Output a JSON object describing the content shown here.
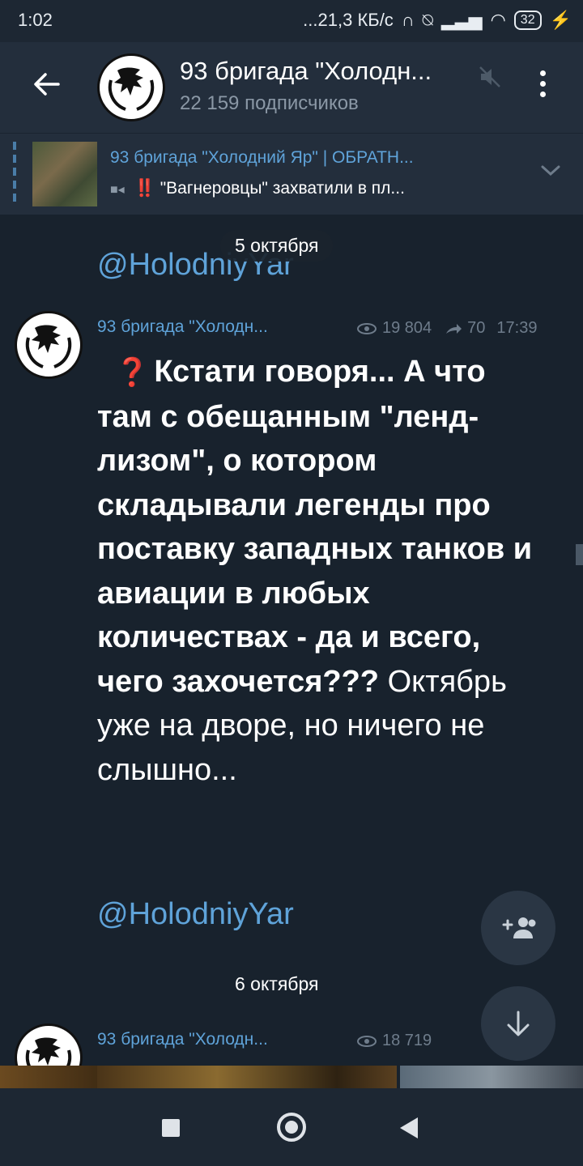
{
  "status_bar": {
    "time": "1:02",
    "speed": "...21,3 КБ/с",
    "battery": "32"
  },
  "header": {
    "channel_name": "93 бригада \"Холодн...",
    "subscribers": "22 159 подписчиков"
  },
  "pinned": {
    "title": "93 бригада \"Холодний Яр\" | ОБРАТН...",
    "text": "\"Вагнеровцы\" захватили в пл...",
    "excl": "‼️"
  },
  "feed": {
    "partial_link": "@HolodniyYar",
    "date_1": "5 октября",
    "message": {
      "author": "93 бригада \"Холодн...",
      "views": "19 804",
      "forwards": "70",
      "time": "17:39",
      "emoji": "❓",
      "bold_part": "Кстати говоря... А что там с обещанным \"ленд-лизом\", о котором складывали легенды про поставку западных танков и авиации в любых количествах - да и всего, чего захочется???",
      "normal_part": "Октябрь уже на дворе, но ничего не слышно...",
      "link": "@HolodniyYar"
    },
    "date_2": "6 октября",
    "message_2": {
      "author": "93 бригада \"Холодн...",
      "views": "18 719"
    }
  },
  "icons": [
    "back-arrow-icon",
    "mute-icon",
    "more-vertical-icon",
    "chevron-down-icon",
    "eye-icon",
    "share-icon",
    "add-user-icon",
    "arrow-down-icon"
  ],
  "colors": {
    "background": "#18222d",
    "header": "#232e3c",
    "accent": "#5fa3d9"
  }
}
